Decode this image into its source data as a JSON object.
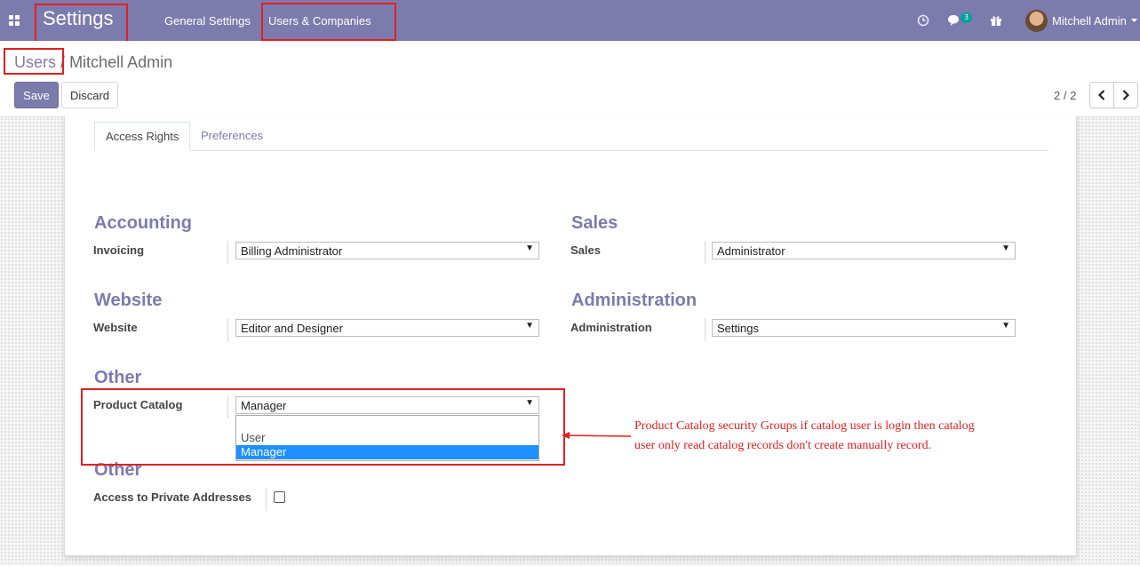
{
  "navbar": {
    "app_title": "Settings",
    "menu": [
      "General Settings",
      "Users & Companies"
    ],
    "message_count": "3",
    "user_name": "Mitchell Admin",
    "icons": [
      "apps-icon",
      "clock-icon",
      "chat-icon",
      "gift-icon",
      "avatar"
    ]
  },
  "breadcrumb": {
    "parent": "Users",
    "separator": "/",
    "current": "Mitchell Admin"
  },
  "actions": {
    "save": "Save",
    "discard": "Discard"
  },
  "pager": {
    "value": "2 / 2"
  },
  "tabs": [
    {
      "label": "Access Rights",
      "active": true
    },
    {
      "label": "Preferences",
      "active": false
    }
  ],
  "sections": {
    "accounting": {
      "title": "Accounting",
      "field_label": "Invoicing",
      "value": "Billing Administrator"
    },
    "sales": {
      "title": "Sales",
      "field_label": "Sales",
      "value": "Administrator"
    },
    "website": {
      "title": "Website",
      "field_label": "Website",
      "value": "Editor and Designer"
    },
    "administration": {
      "title": "Administration",
      "field_label": "Administration",
      "value": "Settings"
    },
    "other1": {
      "title": "Other",
      "field_label": "Product Catalog",
      "value": "Manager",
      "options": [
        "",
        "User",
        "Manager"
      ],
      "highlighted_option": "Manager"
    },
    "other2": {
      "title": "Other",
      "field_label": "Access to Private Addresses",
      "checked": false
    }
  },
  "annotation": {
    "text": "Product Catalog security Groups if catalog user is login then catalog user only read catalog records don't create manually record.",
    "color": "#e02020"
  },
  "colors": {
    "brand": "#7c7bad",
    "highlight": "#e02020",
    "selection": "#1e90ff"
  }
}
